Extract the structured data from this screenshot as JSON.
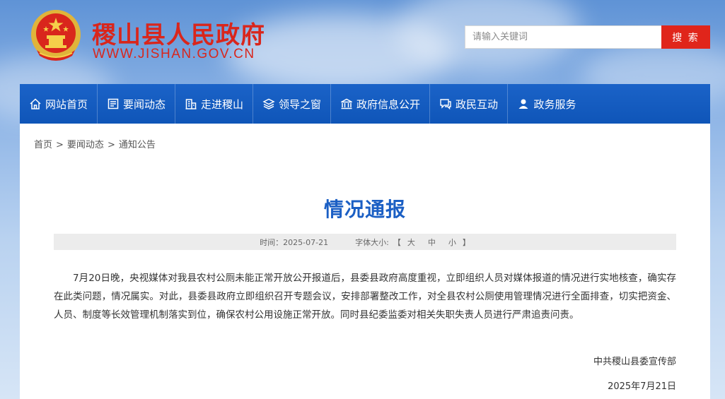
{
  "header": {
    "site_name": "稷山县人民政府",
    "domain": "WWW.JISHAN.GOV.CN",
    "search_placeholder": "请输入关键词",
    "search_button": "搜 索"
  },
  "nav": {
    "items": [
      {
        "label": "网站首页",
        "icon": "home-icon"
      },
      {
        "label": "要闻动态",
        "icon": "news-icon"
      },
      {
        "label": "走进稷山",
        "icon": "building-icon"
      },
      {
        "label": "领导之窗",
        "icon": "layers-icon"
      },
      {
        "label": "政府信息公开",
        "icon": "government-icon"
      },
      {
        "label": "政民互动",
        "icon": "chat-icon"
      },
      {
        "label": "政务服务",
        "icon": "user-service-icon"
      }
    ]
  },
  "breadcrumb": {
    "items": [
      "首页",
      "要闻动态",
      "通知公告"
    ],
    "separator": ">"
  },
  "article": {
    "title": "情况通报",
    "date_label": "时间：2025-07-21",
    "font_size_label": "字体大小:",
    "bracket_open": "【",
    "bracket_close": "】",
    "size_large": "大",
    "size_medium": "中",
    "size_small": "小",
    "body": "7月20日晚，央视媒体对我县农村公厕未能正常开放公开报道后，县委县政府高度重视，立即组织人员对媒体报道的情况进行实地核查，确实存在此类问题，情况属实。对此，县委县政府立即组织召开专题会议，安排部署整改工作，对全县农村公厕使用管理情况进行全面排查，切实把资金、人员、制度等长效管理机制落实到位，确保农村公用设施正常开放。同时县纪委监委对相关失职失责人员进行严肃追责问责。",
    "signature_org": "中共稷山县委宣传部",
    "signature_date": "2025年7月21日"
  },
  "colors": {
    "brand_red": "#d9261c",
    "nav_blue": "#1b63c8",
    "title_blue": "#1b5fc4"
  }
}
